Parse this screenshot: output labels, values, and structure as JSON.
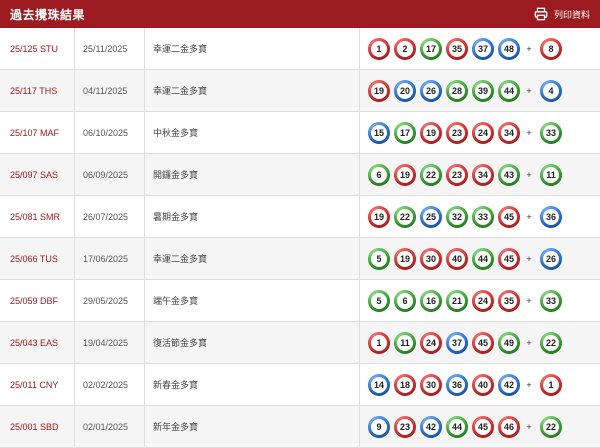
{
  "header": {
    "title": "過去攪珠結果",
    "print_label": "列印資料"
  },
  "colors": {
    "header_bg": "#9b1b20",
    "red": "#e03434",
    "blue": "#2d7be0",
    "green": "#3fae37"
  },
  "draws": [
    {
      "draw": "25/125 STU",
      "date": "25/11/2025",
      "name": "幸運二金多寶",
      "balls": [
        {
          "n": "1",
          "c": "red"
        },
        {
          "n": "2",
          "c": "red"
        },
        {
          "n": "17",
          "c": "green"
        },
        {
          "n": "35",
          "c": "red"
        },
        {
          "n": "37",
          "c": "blue"
        },
        {
          "n": "48",
          "c": "blue"
        }
      ],
      "extra": {
        "n": "8",
        "c": "red"
      }
    },
    {
      "draw": "25/117 THS",
      "date": "04/11/2025",
      "name": "幸運二金多寶",
      "balls": [
        {
          "n": "19",
          "c": "red"
        },
        {
          "n": "20",
          "c": "blue"
        },
        {
          "n": "26",
          "c": "blue"
        },
        {
          "n": "28",
          "c": "green"
        },
        {
          "n": "39",
          "c": "green"
        },
        {
          "n": "44",
          "c": "green"
        }
      ],
      "extra": {
        "n": "4",
        "c": "blue"
      }
    },
    {
      "draw": "25/107 MAF",
      "date": "06/10/2025",
      "name": "中秋金多寶",
      "balls": [
        {
          "n": "15",
          "c": "blue"
        },
        {
          "n": "17",
          "c": "green"
        },
        {
          "n": "19",
          "c": "red"
        },
        {
          "n": "23",
          "c": "red"
        },
        {
          "n": "24",
          "c": "red"
        },
        {
          "n": "34",
          "c": "red"
        }
      ],
      "extra": {
        "n": "33",
        "c": "green"
      }
    },
    {
      "draw": "25/097 SAS",
      "date": "06/09/2025",
      "name": "開鑼金多寶",
      "balls": [
        {
          "n": "6",
          "c": "green"
        },
        {
          "n": "19",
          "c": "red"
        },
        {
          "n": "22",
          "c": "green"
        },
        {
          "n": "23",
          "c": "red"
        },
        {
          "n": "34",
          "c": "red"
        },
        {
          "n": "43",
          "c": "green"
        }
      ],
      "extra": {
        "n": "11",
        "c": "green"
      }
    },
    {
      "draw": "25/081 SMR",
      "date": "26/07/2025",
      "name": "暑期金多寶",
      "balls": [
        {
          "n": "19",
          "c": "red"
        },
        {
          "n": "22",
          "c": "green"
        },
        {
          "n": "25",
          "c": "blue"
        },
        {
          "n": "32",
          "c": "green"
        },
        {
          "n": "33",
          "c": "green"
        },
        {
          "n": "45",
          "c": "red"
        }
      ],
      "extra": {
        "n": "36",
        "c": "blue"
      }
    },
    {
      "draw": "25/066 TUS",
      "date": "17/06/2025",
      "name": "幸運二金多寶",
      "balls": [
        {
          "n": "5",
          "c": "green"
        },
        {
          "n": "19",
          "c": "red"
        },
        {
          "n": "30",
          "c": "red"
        },
        {
          "n": "40",
          "c": "red"
        },
        {
          "n": "44",
          "c": "green"
        },
        {
          "n": "45",
          "c": "red"
        }
      ],
      "extra": {
        "n": "26",
        "c": "blue"
      }
    },
    {
      "draw": "25/059 DBF",
      "date": "29/05/2025",
      "name": "端午金多寶",
      "balls": [
        {
          "n": "5",
          "c": "green"
        },
        {
          "n": "6",
          "c": "green"
        },
        {
          "n": "16",
          "c": "green"
        },
        {
          "n": "21",
          "c": "green"
        },
        {
          "n": "24",
          "c": "red"
        },
        {
          "n": "35",
          "c": "red"
        }
      ],
      "extra": {
        "n": "33",
        "c": "green"
      }
    },
    {
      "draw": "25/043 EAS",
      "date": "19/04/2025",
      "name": "復活節金多寶",
      "balls": [
        {
          "n": "1",
          "c": "red"
        },
        {
          "n": "11",
          "c": "green"
        },
        {
          "n": "24",
          "c": "red"
        },
        {
          "n": "37",
          "c": "blue"
        },
        {
          "n": "45",
          "c": "red"
        },
        {
          "n": "49",
          "c": "green"
        }
      ],
      "extra": {
        "n": "22",
        "c": "green"
      }
    },
    {
      "draw": "25/011 CNY",
      "date": "02/02/2025",
      "name": "新春金多寶",
      "balls": [
        {
          "n": "14",
          "c": "blue"
        },
        {
          "n": "18",
          "c": "red"
        },
        {
          "n": "30",
          "c": "red"
        },
        {
          "n": "36",
          "c": "blue"
        },
        {
          "n": "40",
          "c": "red"
        },
        {
          "n": "42",
          "c": "blue"
        }
      ],
      "extra": {
        "n": "1",
        "c": "red"
      }
    },
    {
      "draw": "25/001 SBD",
      "date": "02/01/2025",
      "name": "新年金多寶",
      "balls": [
        {
          "n": "9",
          "c": "blue"
        },
        {
          "n": "23",
          "c": "red"
        },
        {
          "n": "42",
          "c": "blue"
        },
        {
          "n": "44",
          "c": "green"
        },
        {
          "n": "45",
          "c": "red"
        },
        {
          "n": "46",
          "c": "red"
        }
      ],
      "extra": {
        "n": "22",
        "c": "green"
      }
    }
  ]
}
